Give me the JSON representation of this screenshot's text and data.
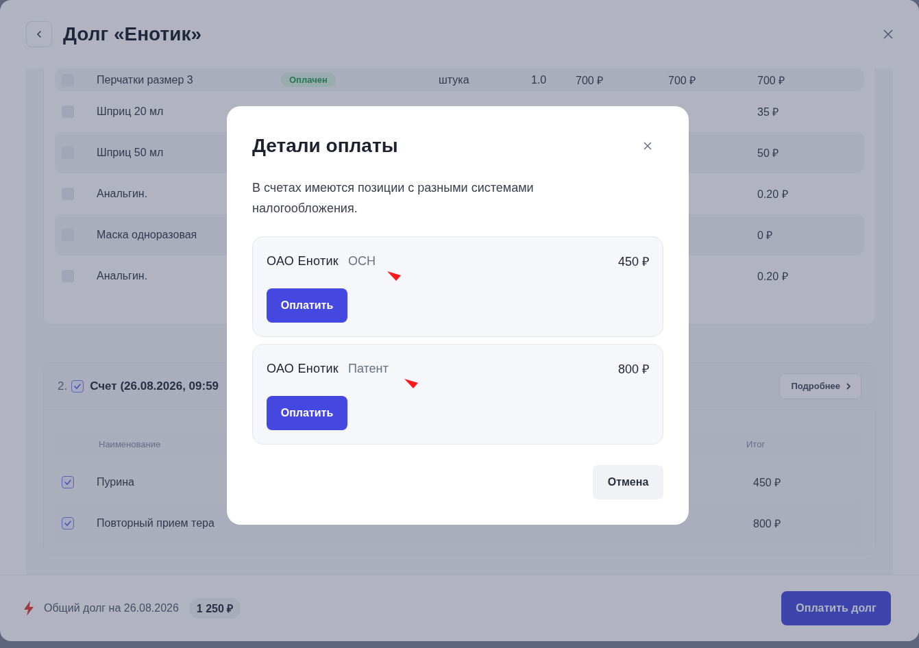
{
  "header": {
    "title": "Долг «Енотик»"
  },
  "invoice_1": {
    "rows": [
      {
        "name": "Перчатки размер 3",
        "status": "Оплачен",
        "unit": "штука",
        "quantity": "1.0",
        "price": "700 ₽",
        "amount": "700 ₽",
        "total": "700 ₽",
        "checked": false
      },
      {
        "name": "Шприц 20 мл",
        "total": "35 ₽",
        "checked": false
      },
      {
        "name": "Шприц 50 мл",
        "total": "50 ₽",
        "checked": false
      },
      {
        "name": "Анальгин.",
        "total": "0.20 ₽",
        "checked": false
      },
      {
        "name": "Маска одноразовая",
        "total": "0 ₽",
        "checked": false
      },
      {
        "name": "Анальгин.",
        "total": "0.20 ₽",
        "checked": false
      }
    ]
  },
  "invoice_2": {
    "number": "2.",
    "checked": true,
    "title": "Счет (26.08.2026, 09:59",
    "details_button": "Подробнее",
    "columns": [
      "Наименование",
      "Итог"
    ],
    "rows": [
      {
        "name": "Пурина",
        "total": "450 ₽",
        "checked": true
      },
      {
        "name": "Повторный прием тера",
        "total": "800 ₽",
        "checked": true
      }
    ]
  },
  "footer": {
    "label": "Общий долг на 26.08.2026",
    "amount": "1 250 ₽",
    "pay_button": "Оплатить долг"
  },
  "modal": {
    "title": "Детали оплаты",
    "message": "В счетах имеются позиции с разными системами налогообложения.",
    "payments": [
      {
        "org": "ОАО Енотик",
        "tax": "ОСН",
        "amount": "450 ₽",
        "button": "Оплатить"
      },
      {
        "org": "ОАО Енотик",
        "tax": "Патент",
        "amount": "800 ₽",
        "button": "Оплатить"
      }
    ],
    "cancel": "Отмена"
  }
}
